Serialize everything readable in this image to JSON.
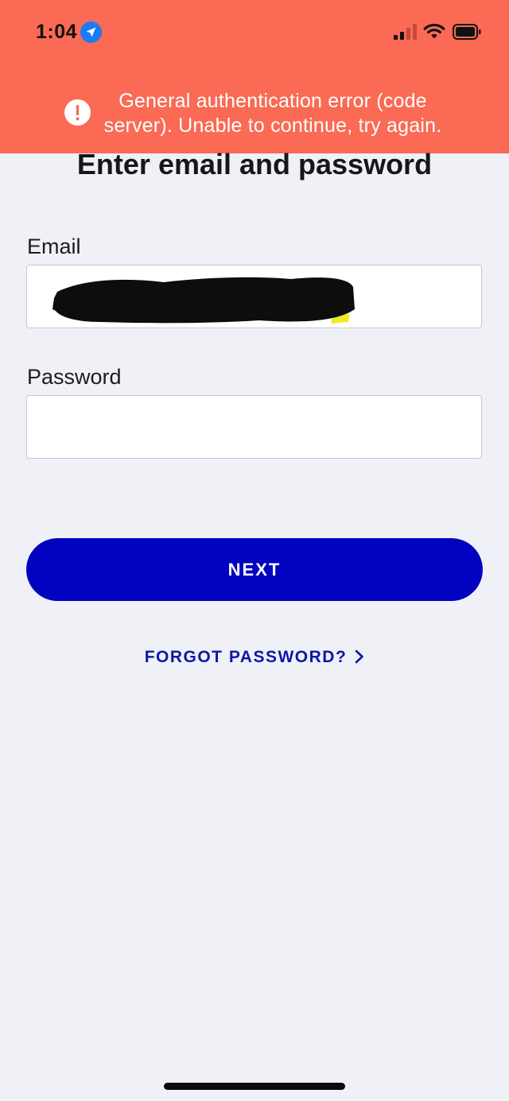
{
  "status_bar": {
    "time": "1:04",
    "icons": [
      "location-arrow-icon",
      "cellular-signal-icon",
      "wifi-icon",
      "battery-icon"
    ]
  },
  "error_banner": {
    "message": "General authentication error (code server). Unable to continue, try again.",
    "icon": "exclamation-icon",
    "background_color": "#fa6a54"
  },
  "page": {
    "title": "Enter email and password"
  },
  "form": {
    "email_label": "Email",
    "email_value": "",
    "password_label": "Password",
    "password_value": "",
    "next_label": "NEXT",
    "forgot_label": "FORGOT PASSWORD?",
    "accent_color": "#0202c1"
  }
}
